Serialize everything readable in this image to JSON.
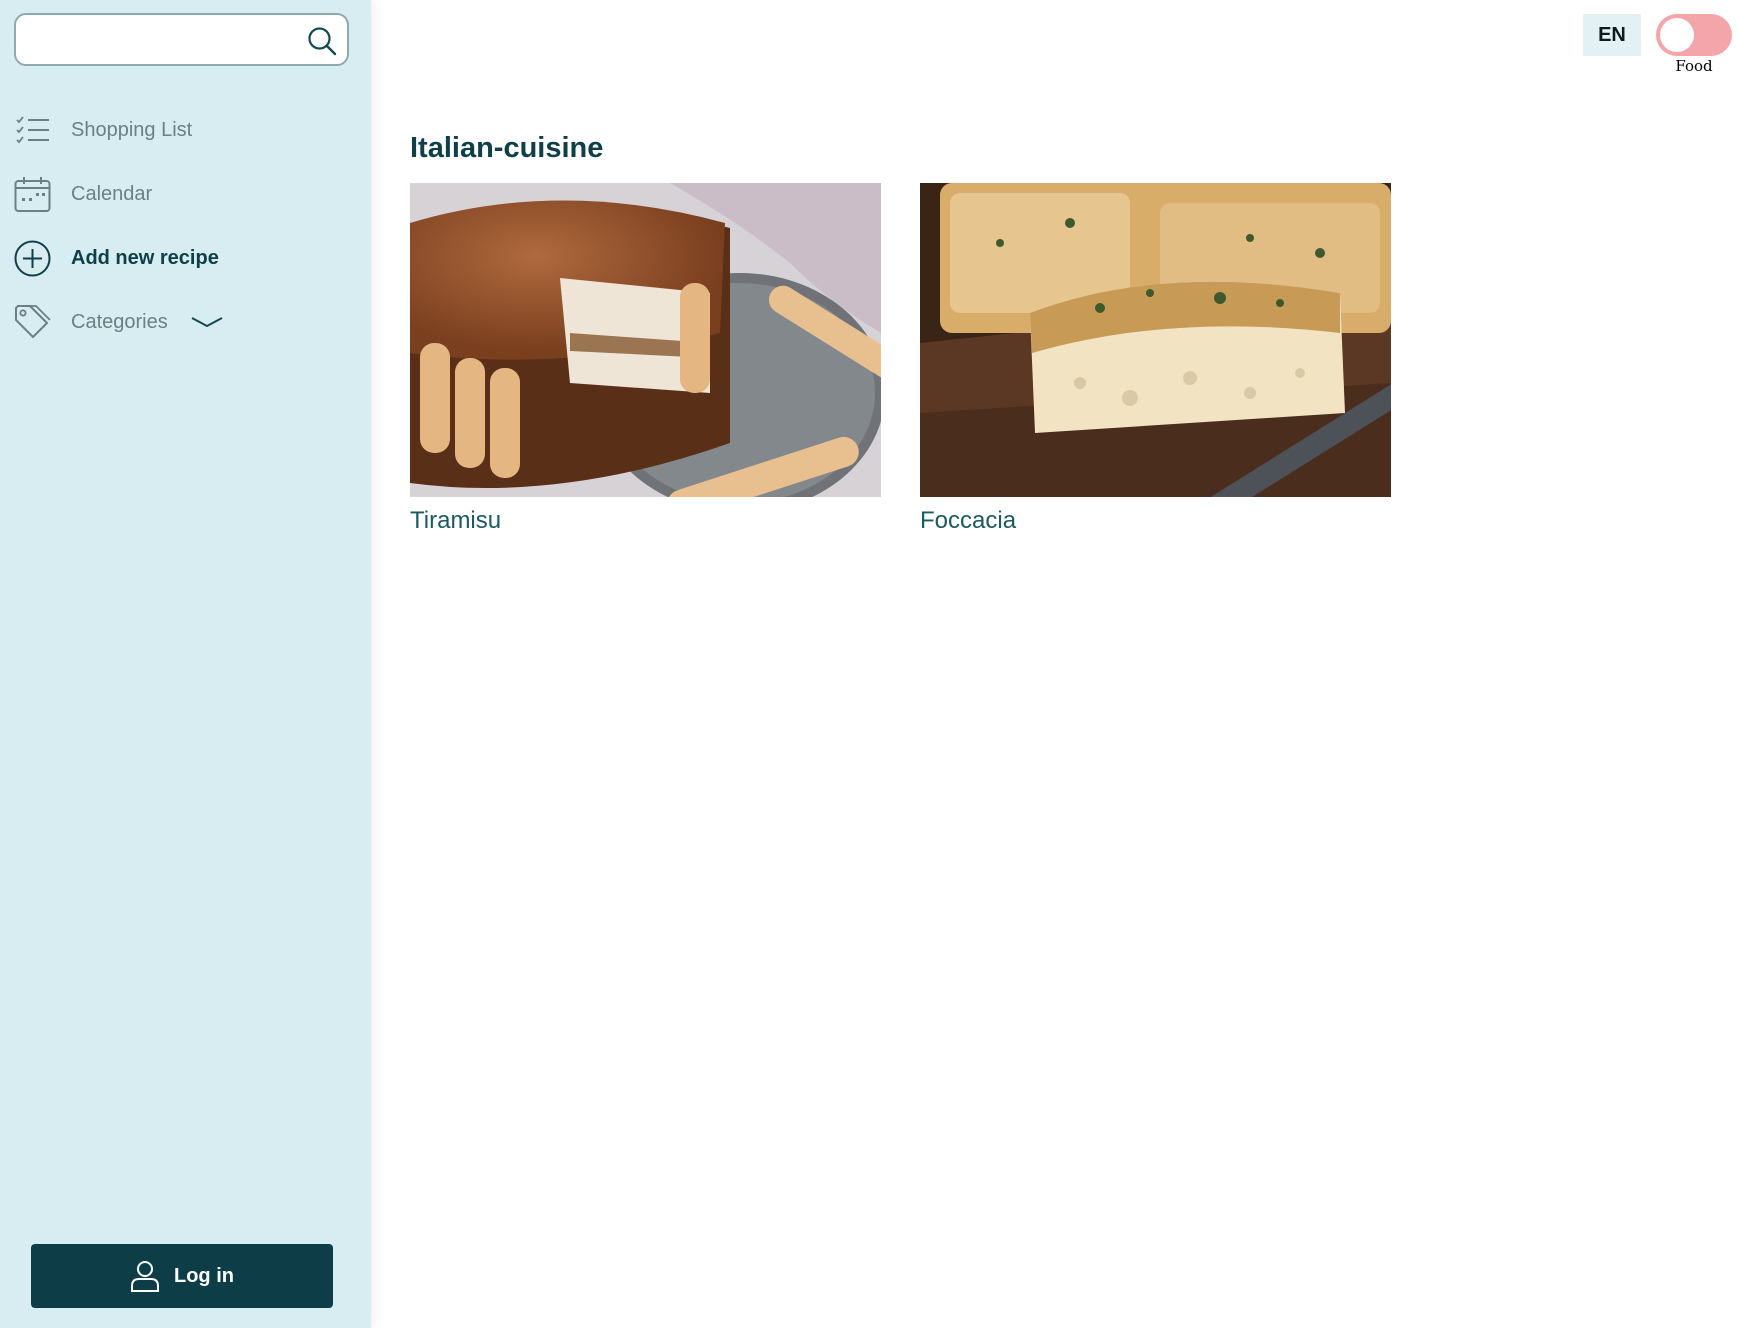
{
  "search": {
    "placeholder": "",
    "value": ""
  },
  "sidebar": {
    "items": [
      {
        "label": "Shopping List",
        "icon": "checklist-icon"
      },
      {
        "label": "Calendar",
        "icon": "calendar-icon"
      },
      {
        "label": "Add new recipe",
        "icon": "plus-circle-icon"
      },
      {
        "label": "Categories",
        "icon": "tag-icon"
      }
    ],
    "login_label": "Log in"
  },
  "header": {
    "language": "EN",
    "toggle_label": "Food"
  },
  "main": {
    "title": "Italian-cuisine",
    "recipes": [
      {
        "name": "Tiramisu"
      },
      {
        "name": "Foccacia"
      }
    ]
  },
  "colors": {
    "sidebar_bg": "#d8edf1",
    "accent": "#0d3e48",
    "toggle": "#f4a5aa"
  }
}
